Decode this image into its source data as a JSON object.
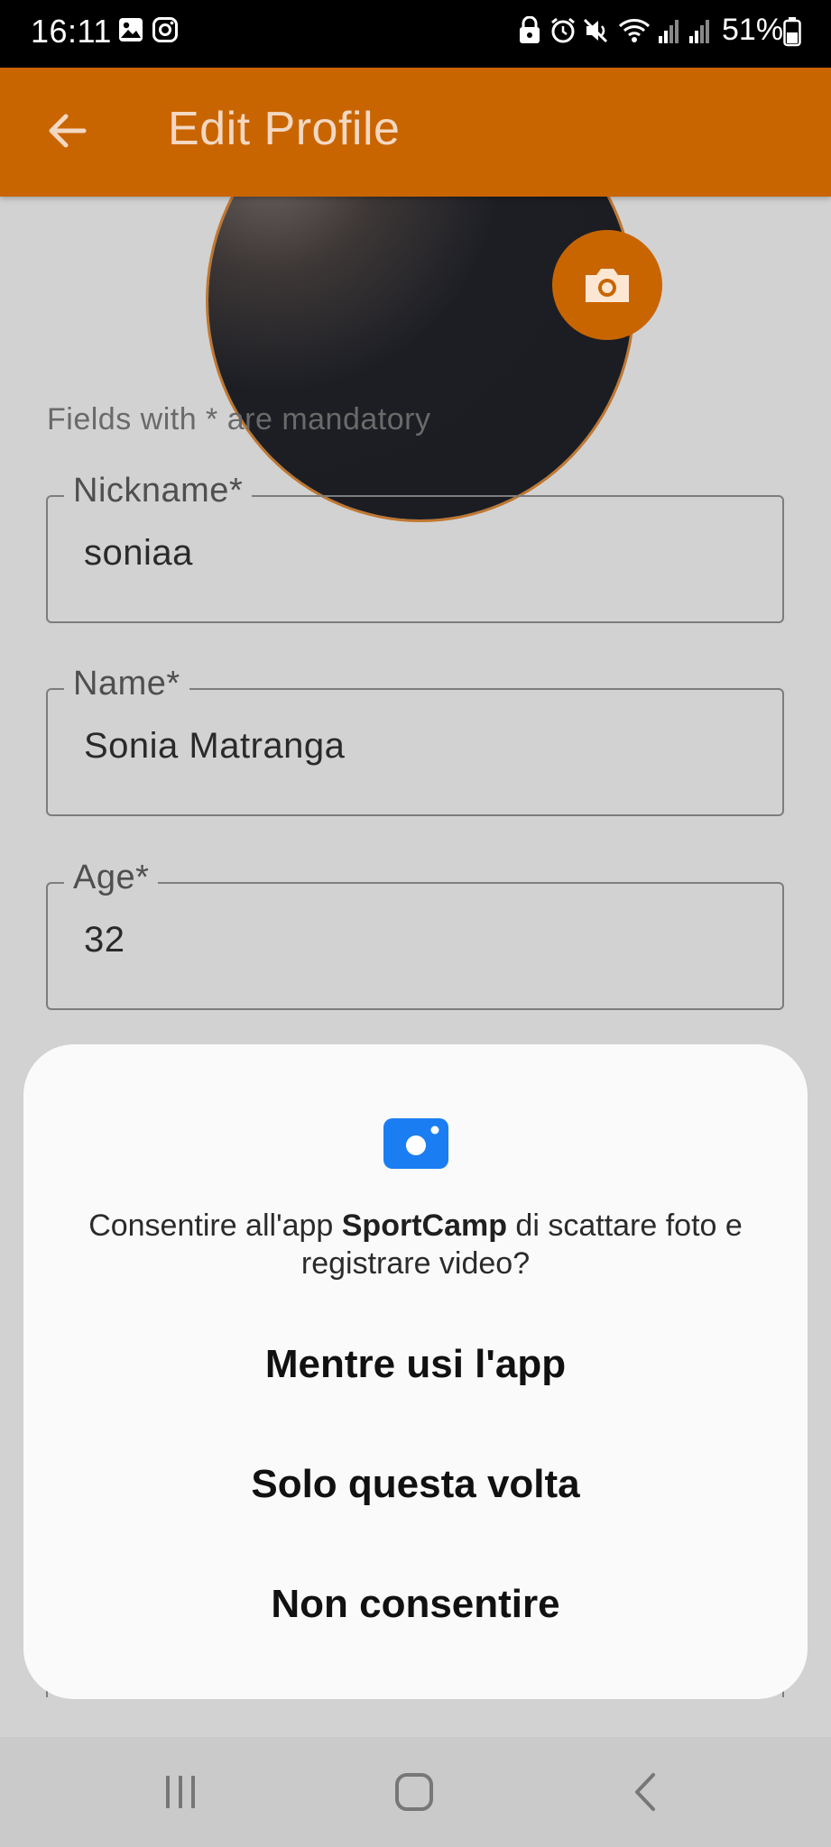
{
  "status_bar": {
    "time": "16:11",
    "battery": "51%",
    "icons": [
      "gallery-icon",
      "instagram-icon",
      "lock-icon",
      "alarm-icon",
      "mute-icon",
      "wifi-icon",
      "signal-icon",
      "signal-icon",
      "battery-icon"
    ]
  },
  "app_bar": {
    "title": "Edit Profile",
    "back_icon": "arrow-left-icon",
    "color": "#c96500"
  },
  "avatar": {
    "camera_icon": "camera-icon"
  },
  "form": {
    "hint": "Fields with * are mandatory",
    "fields": [
      {
        "label": "Nickname*",
        "value": "soniaa"
      },
      {
        "label": "Name*",
        "value": "Sonia Matranga"
      },
      {
        "label": "Age*",
        "value": "32"
      }
    ]
  },
  "permission_dialog": {
    "icon": "camera-icon",
    "message_prefix": "Consentire all'app ",
    "app_name": "SportCamp",
    "message_suffix": " di scattare foto e registrare video?",
    "options": [
      "Mentre usi l'app",
      "Solo questa volta",
      "Non consentire"
    ],
    "icon_color": "#1a7ef2"
  },
  "nav_bar": {
    "icons": [
      "recent-apps-icon",
      "home-icon",
      "back-icon"
    ]
  }
}
